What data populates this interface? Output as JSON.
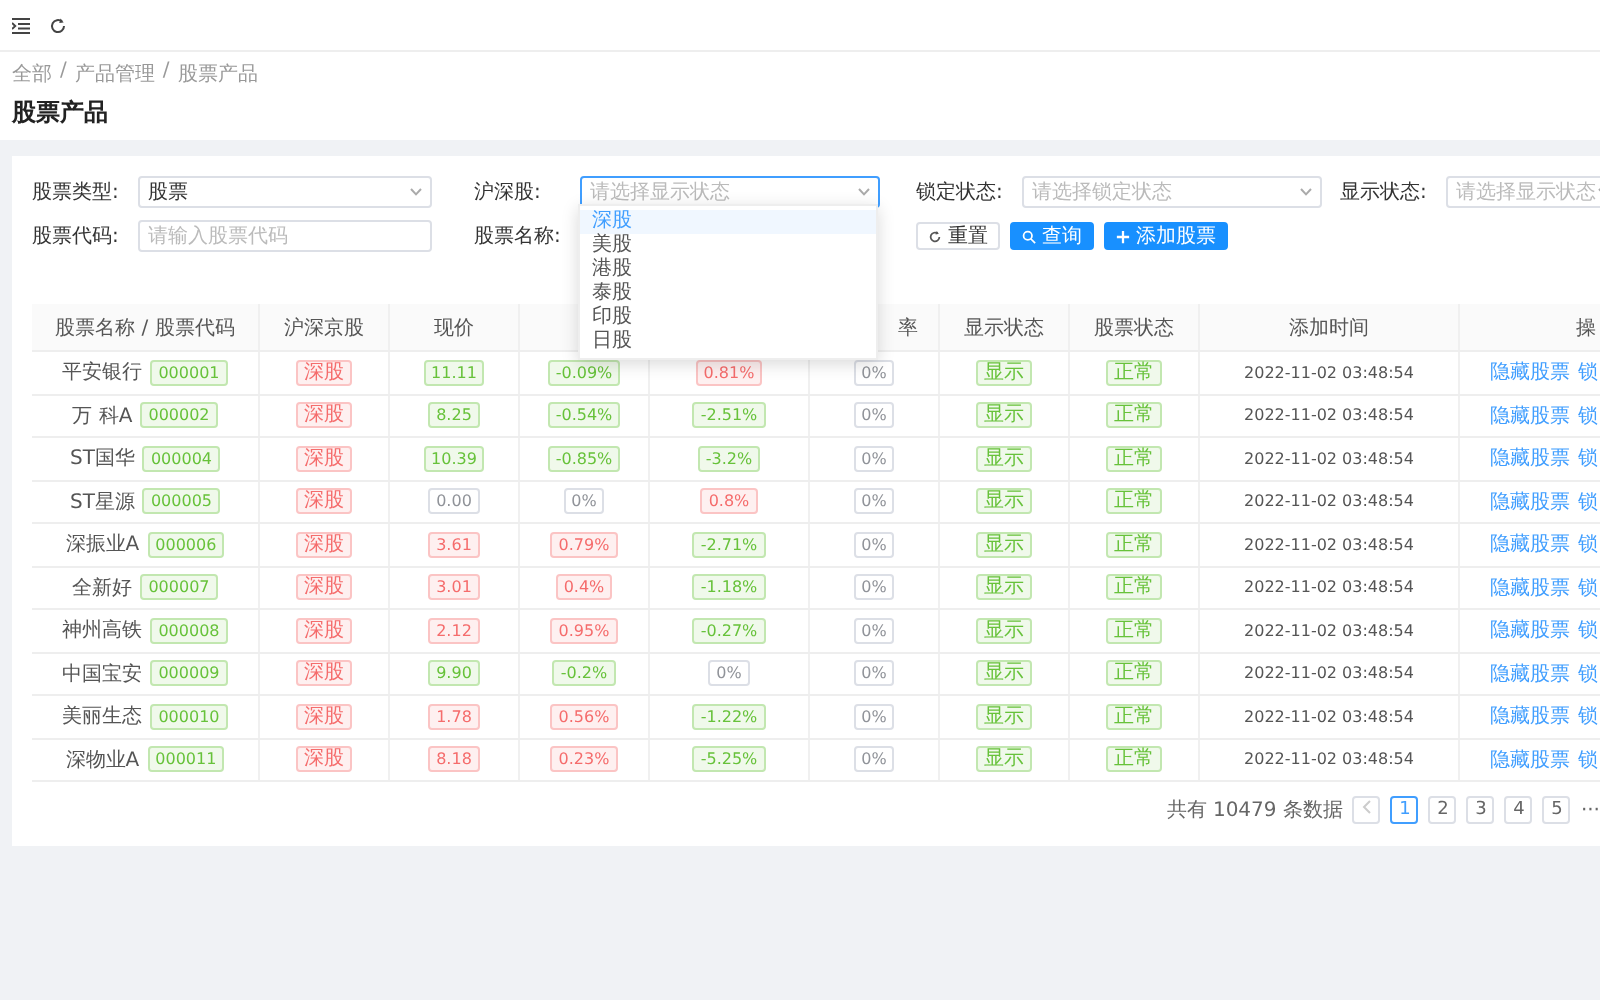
{
  "breadcrumb": {
    "items": [
      "全部",
      "产品管理",
      "股票产品"
    ],
    "separator": "/"
  },
  "page_title": "股票产品",
  "filters": [
    {
      "label": "股票类型:",
      "kind": "select",
      "value": "股票"
    },
    {
      "label": "沪深股:",
      "kind": "select",
      "placeholder": "请选择显示状态",
      "open": true,
      "options": [
        {
          "label": "深股",
          "selected": true
        },
        {
          "label": "美股",
          "selected": false
        },
        {
          "label": "港股",
          "selected": false
        },
        {
          "label": "泰股",
          "selected": false
        },
        {
          "label": "印股",
          "selected": false
        },
        {
          "label": "日股",
          "selected": false
        }
      ]
    },
    {
      "label": "锁定状态:",
      "kind": "select",
      "placeholder": "请选择锁定状态"
    },
    {
      "label": "显示状态:",
      "kind": "select",
      "placeholder": "请选择显示状态"
    },
    {
      "label": "股票代码:",
      "kind": "input",
      "placeholder": "请输入股票代码"
    },
    {
      "label": "股票名称:",
      "kind": "label"
    }
  ],
  "buttons": [
    {
      "label": "重置",
      "kind": "reset"
    },
    {
      "label": "查询",
      "kind": "search"
    },
    {
      "label": "添加股票",
      "kind": "add"
    }
  ],
  "table": {
    "columns": [
      {
        "label": "股票名称 / 股票代码"
      },
      {
        "label": "沪深京股"
      },
      {
        "label": "现价"
      },
      {},
      {},
      {
        "label": "率"
      },
      {
        "label": "显示状态"
      },
      {
        "label": "股票状态"
      },
      {
        "label": "添加时间"
      },
      {
        "label": "操"
      }
    ],
    "rows": [
      {
        "name": "平安银行",
        "code": "000001",
        "market": "深股",
        "price": {
          "text": "11.11",
          "kind": "fall"
        },
        "change": {
          "text": "-0.09%",
          "kind": "fall"
        },
        "column_5": {
          "text": "0.81%",
          "kind": "rise"
        },
        "column_6": {
          "text": "0%",
          "kind": "flat"
        },
        "display": "显示",
        "status": "正常",
        "added": "2022-11-02 03:48:54",
        "actions": [
          "隐藏股票",
          "锁"
        ]
      },
      {
        "name": "万 科A",
        "code": "000002",
        "market": "深股",
        "price": {
          "text": "8.25",
          "kind": "fall"
        },
        "change": {
          "text": "-0.54%",
          "kind": "fall"
        },
        "column_5": {
          "text": "-2.51%",
          "kind": "fall"
        },
        "column_6": {
          "text": "0%",
          "kind": "flat"
        },
        "display": "显示",
        "status": "正常",
        "added": "2022-11-02 03:48:54",
        "actions": [
          "隐藏股票",
          "锁"
        ]
      },
      {
        "name": "ST国华",
        "code": "000004",
        "market": "深股",
        "price": {
          "text": "10.39",
          "kind": "fall"
        },
        "change": {
          "text": "-0.85%",
          "kind": "fall"
        },
        "column_5": {
          "text": "-3.2%",
          "kind": "fall"
        },
        "column_6": {
          "text": "0%",
          "kind": "flat"
        },
        "display": "显示",
        "status": "正常",
        "added": "2022-11-02 03:48:54",
        "actions": [
          "隐藏股票",
          "锁"
        ]
      },
      {
        "name": "ST星源",
        "code": "000005",
        "market": "深股",
        "price": {
          "text": "0.00",
          "kind": "flat"
        },
        "change": {
          "text": "0%",
          "kind": "flat"
        },
        "column_5": {
          "text": "0.8%",
          "kind": "rise"
        },
        "column_6": {
          "text": "0%",
          "kind": "flat"
        },
        "display": "显示",
        "status": "正常",
        "added": "2022-11-02 03:48:54",
        "actions": [
          "隐藏股票",
          "锁"
        ]
      },
      {
        "name": "深振业A",
        "code": "000006",
        "market": "深股",
        "price": {
          "text": "3.61",
          "kind": "rise"
        },
        "change": {
          "text": "0.79%",
          "kind": "rise"
        },
        "column_5": {
          "text": "-2.71%",
          "kind": "fall"
        },
        "column_6": {
          "text": "0%",
          "kind": "flat"
        },
        "display": "显示",
        "status": "正常",
        "added": "2022-11-02 03:48:54",
        "actions": [
          "隐藏股票",
          "锁"
        ]
      },
      {
        "name": "全新好",
        "code": "000007",
        "market": "深股",
        "price": {
          "text": "3.01",
          "kind": "rise"
        },
        "change": {
          "text": "0.4%",
          "kind": "rise"
        },
        "column_5": {
          "text": "-1.18%",
          "kind": "fall"
        },
        "column_6": {
          "text": "0%",
          "kind": "flat"
        },
        "display": "显示",
        "status": "正常",
        "added": "2022-11-02 03:48:54",
        "actions": [
          "隐藏股票",
          "锁"
        ]
      },
      {
        "name": "神州高铁",
        "code": "000008",
        "market": "深股",
        "price": {
          "text": "2.12",
          "kind": "rise"
        },
        "change": {
          "text": "0.95%",
          "kind": "rise"
        },
        "column_5": {
          "text": "-0.27%",
          "kind": "fall"
        },
        "column_6": {
          "text": "0%",
          "kind": "flat"
        },
        "display": "显示",
        "status": "正常",
        "added": "2022-11-02 03:48:54",
        "actions": [
          "隐藏股票",
          "锁"
        ]
      },
      {
        "name": "中国宝安",
        "code": "000009",
        "market": "深股",
        "price": {
          "text": "9.90",
          "kind": "fall"
        },
        "change": {
          "text": "-0.2%",
          "kind": "fall"
        },
        "column_5": {
          "text": "0%",
          "kind": "flat"
        },
        "column_6": {
          "text": "0%",
          "kind": "flat"
        },
        "display": "显示",
        "status": "正常",
        "added": "2022-11-02 03:48:54",
        "actions": [
          "隐藏股票",
          "锁"
        ]
      },
      {
        "name": "美丽生态",
        "code": "000010",
        "market": "深股",
        "price": {
          "text": "1.78",
          "kind": "rise"
        },
        "change": {
          "text": "0.56%",
          "kind": "rise"
        },
        "column_5": {
          "text": "-1.22%",
          "kind": "fall"
        },
        "column_6": {
          "text": "0%",
          "kind": "flat"
        },
        "display": "显示",
        "status": "正常",
        "added": "2022-11-02 03:48:54",
        "actions": [
          "隐藏股票",
          "锁"
        ]
      },
      {
        "name": "深物业A",
        "code": "000011",
        "market": "深股",
        "price": {
          "text": "8.18",
          "kind": "rise"
        },
        "change": {
          "text": "0.23%",
          "kind": "rise"
        },
        "column_5": {
          "text": "-5.25%",
          "kind": "fall"
        },
        "column_6": {
          "text": "0%",
          "kind": "flat"
        },
        "display": "显示",
        "status": "正常",
        "added": "2022-11-02 03:48:54",
        "actions": [
          "隐藏股票",
          "锁"
        ]
      }
    ]
  },
  "pagination": {
    "total": "共有 10479 条数据",
    "pages": [
      {
        "label": "1",
        "selected": true
      },
      {
        "label": "2",
        "selected": false
      },
      {
        "label": "3",
        "selected": false
      },
      {
        "label": "4",
        "selected": false
      },
      {
        "label": "5",
        "selected": false
      }
    ],
    "more": "···"
  }
}
